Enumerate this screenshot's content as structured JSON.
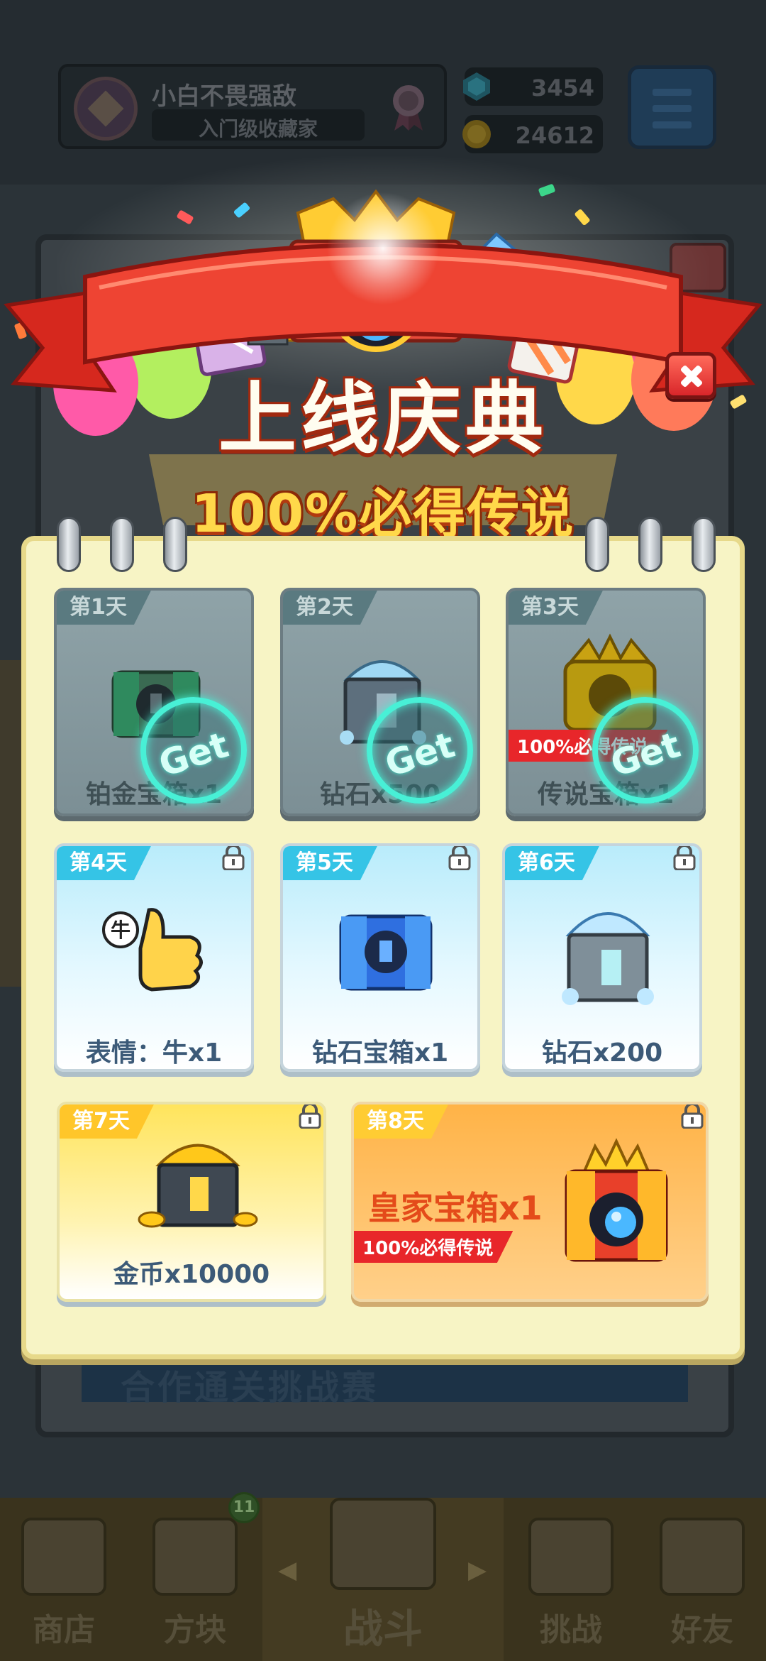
{
  "background": {
    "player_name": "小白不畏强敌",
    "player_title": "入门级收藏家",
    "gems": "3454",
    "coins": "24612",
    "banner_text": "合作通关挑战赛",
    "nav": [
      {
        "label": "商店",
        "icon": "shop-icon"
      },
      {
        "label": "方块",
        "icon": "block-icon"
      },
      {
        "label": "战斗",
        "icon": "battle-icon"
      },
      {
        "label": "挑战",
        "icon": "challenge-icon"
      },
      {
        "label": "好友",
        "icon": "friends-icon"
      }
    ],
    "block_badge": "11"
  },
  "popup": {
    "title": "上线庆典",
    "subtitle": "100%必得传说",
    "close_icon": "close-icon",
    "days": [
      {
        "day": "第1天",
        "label": "铂金宝箱x1",
        "status": "claimed",
        "stamp": "Get",
        "item": "platinum-chest-icon"
      },
      {
        "day": "第2天",
        "label": "钻石x500",
        "status": "claimed",
        "stamp": "Get",
        "item": "diamond-crate-icon"
      },
      {
        "day": "第3天",
        "label": "传说宝箱x1",
        "status": "claimed",
        "stamp": "Get",
        "badge": "100%必得传说",
        "item": "legend-chest-icon"
      },
      {
        "day": "第4天",
        "label": "表情：牛x1",
        "status": "locked",
        "item": "thumbs-up-emote-icon",
        "emote_char": "牛"
      },
      {
        "day": "第5天",
        "label": "钻石宝箱x1",
        "status": "locked",
        "item": "diamond-chest-icon"
      },
      {
        "day": "第6天",
        "label": "钻石x200",
        "status": "locked",
        "item": "diamond-crate-icon"
      },
      {
        "day": "第7天",
        "label": "金币x10000",
        "status": "locked",
        "item": "gold-crate-icon"
      },
      {
        "day": "第8天",
        "label": "皇家宝箱x1",
        "status": "locked",
        "badge": "100%必得传说",
        "item": "royal-chest-icon"
      }
    ]
  },
  "colors": {
    "board": "#f7f4c5",
    "ribbon": "#e8352a",
    "stamp": "#48f0d6",
    "badge_red": "#e8262a"
  }
}
